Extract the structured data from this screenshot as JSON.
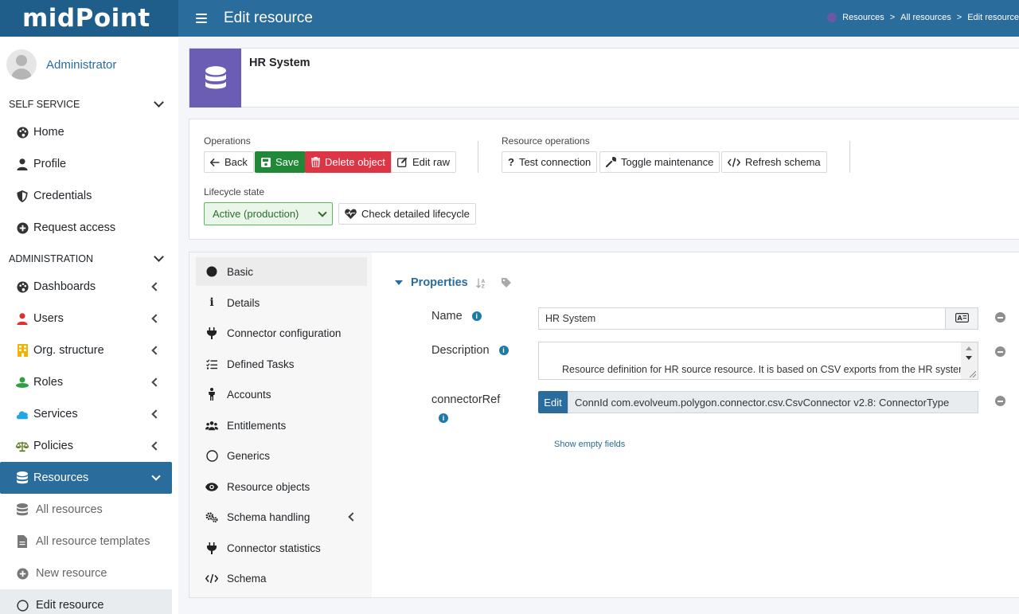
{
  "header": {
    "logo": "midPoint",
    "title": "Edit resource",
    "breadcrumbs": [
      "Resources",
      "All resources",
      "Edit resource"
    ]
  },
  "sidebar": {
    "user": "Administrator",
    "sections": {
      "self_service": "SELF SERVICE",
      "administration": "ADMINISTRATION"
    },
    "self_items": [
      {
        "label": "Home",
        "icon": "palette-icon"
      },
      {
        "label": "Profile",
        "icon": "user-icon"
      },
      {
        "label": "Credentials",
        "icon": "shield-icon"
      },
      {
        "label": "Request access",
        "icon": "plus-circle-icon"
      }
    ],
    "admin_items": [
      {
        "label": "Dashboards",
        "icon": "palette-icon"
      },
      {
        "label": "Users",
        "icon": "user-icon",
        "color": "#e03131"
      },
      {
        "label": "Org. structure",
        "icon": "building-icon",
        "color": "#f0b400"
      },
      {
        "label": "Roles",
        "icon": "role-icon",
        "color": "#2f9e44"
      },
      {
        "label": "Services",
        "icon": "cloud-icon",
        "color": "#1c7ed6"
      },
      {
        "label": "Policies",
        "icon": "balance-icon",
        "color": "#5c7a1f"
      },
      {
        "label": "Resources",
        "icon": "database-icon"
      }
    ],
    "resource_subitems": [
      {
        "label": "All resources",
        "icon": "database-icon"
      },
      {
        "label": "All resource templates",
        "icon": "file-icon"
      },
      {
        "label": "New resource",
        "icon": "plus-circle-icon"
      },
      {
        "label": "Edit resource",
        "icon": "circle-icon"
      }
    ]
  },
  "summary": {
    "name": "HR System",
    "icon": "database-icon",
    "icon_bg": "#6b5db4"
  },
  "operations": {
    "label": "Operations",
    "back": "Back",
    "save": "Save",
    "delete": "Delete object",
    "edit_raw": "Edit raw",
    "resource_ops_label": "Resource operations",
    "test_connection": "Test connection",
    "toggle_maintenance": "Toggle maintenance",
    "refresh_schema": "Refresh schema",
    "lifecycle_label": "Lifecycle state",
    "lifecycle_value": "Active (production)",
    "check_lifecycle": "Check detailed lifecycle"
  },
  "tabs": [
    {
      "label": "Basic",
      "icon": "filled-circle-icon"
    },
    {
      "label": "Details",
      "icon": "info-icon"
    },
    {
      "label": "Connector configuration",
      "icon": "plug-icon"
    },
    {
      "label": "Defined Tasks",
      "icon": "task-list-icon"
    },
    {
      "label": "Accounts",
      "icon": "person-icon"
    },
    {
      "label": "Entitlements",
      "icon": "users-icon"
    },
    {
      "label": "Generics",
      "icon": "circle-icon"
    },
    {
      "label": "Resource objects",
      "icon": "eye-icon"
    },
    {
      "label": "Schema handling",
      "icon": "cogs-icon"
    },
    {
      "label": "Connector statistics",
      "icon": "plug-icon"
    },
    {
      "label": "Schema",
      "icon": "code-icon"
    }
  ],
  "properties": {
    "title": "Properties",
    "name_label": "Name",
    "name_value": "HR System",
    "description_label": "Description",
    "description_value": "Resource definition for HR source resource. It is based on CSV exports from the HR system.",
    "connector_label": "connectorRef",
    "connector_edit": "Edit",
    "connector_value": "ConnId com.evolveum.polygon.connector.csv.CsvConnector v2.8: ConnectorType",
    "show_empty": "Show empty fields"
  }
}
